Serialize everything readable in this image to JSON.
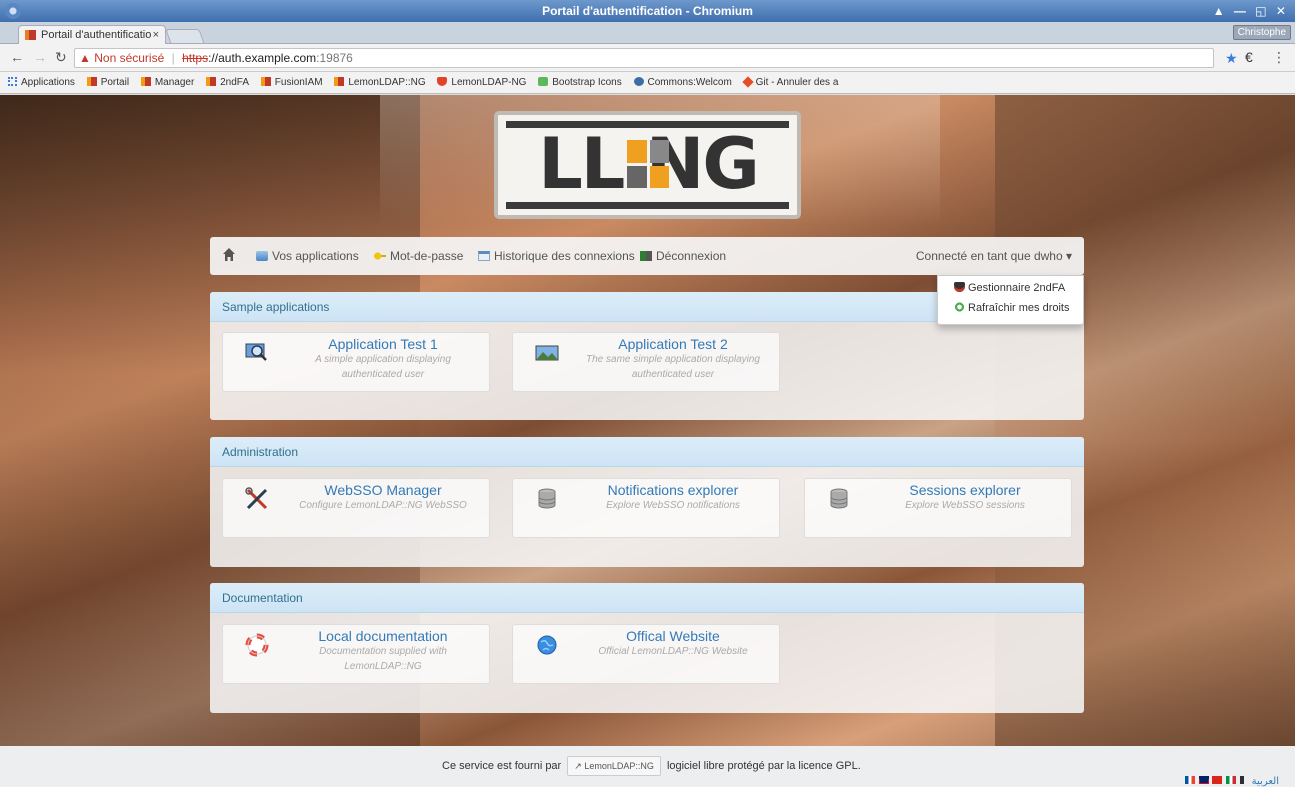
{
  "window": {
    "title": "Portail d'authentification - Chromium",
    "controls": "▲ — ◱ ✕"
  },
  "tabs": [
    {
      "label": "Portail d'authentificatio",
      "close": "×"
    }
  ],
  "profile": "Christophe",
  "toolbar": {
    "warning_icon": "▲",
    "security": "Non sécurisé",
    "separator": "|",
    "scheme": "https",
    "host": "://auth.example.com",
    "port": ":19876"
  },
  "bookmarks": [
    "Applications",
    "Portail",
    "Manager",
    "2ndFA",
    "FusionIAM",
    "LemonLDAP::NG",
    "LemonLDAP-NG",
    "Bootstrap Icons",
    "Commons:Welcom",
    "Git - Annuler des a"
  ],
  "logo": {
    "text": "LL  NG"
  },
  "nav": {
    "apps": "Vos applications",
    "password": "Mot-de-passe",
    "history": "Historique des connexions",
    "logout": "Déconnexion",
    "user": "Connecté en tant que dwho ▾"
  },
  "dropdown": {
    "item1": "Gestionnaire 2ndFA",
    "item2": "Rafraîchir mes droits"
  },
  "sections": [
    {
      "title": "Sample applications",
      "apps": [
        {
          "name": "Application Test 1",
          "desc": "A simple application displaying authenticated user",
          "icon": "magnifier-icon"
        },
        {
          "name": "Application Test 2",
          "desc": "The same simple application displaying authenticated user",
          "icon": "landscape-icon"
        }
      ]
    },
    {
      "title": "Administration",
      "apps": [
        {
          "name": "WebSSO Manager",
          "desc": "Configure LemonLDAP::NG WebSSO",
          "icon": "tools-icon"
        },
        {
          "name": "Notifications explorer",
          "desc": "Explore WebSSO notifications",
          "icon": "database-icon"
        },
        {
          "name": "Sessions explorer",
          "desc": "Explore WebSSO sessions",
          "icon": "database-icon"
        }
      ]
    },
    {
      "title": "Documentation",
      "apps": [
        {
          "name": "Local documentation",
          "desc": "Documentation supplied with LemonLDAP::NG",
          "icon": "lifebuoy-icon"
        },
        {
          "name": "Offical Website",
          "desc": "Official LemonLDAP::NG Website",
          "icon": "globe-icon"
        }
      ]
    }
  ],
  "footer": {
    "pre": "Ce service est fourni par",
    "button": "LemonLDAP::NG",
    "post": "logiciel libre protégé par la licence GPL.",
    "arabic": "العربية"
  },
  "colors": {
    "link": "#337ab7",
    "panel_head": "#31708f",
    "insecure": "#c0392b"
  }
}
